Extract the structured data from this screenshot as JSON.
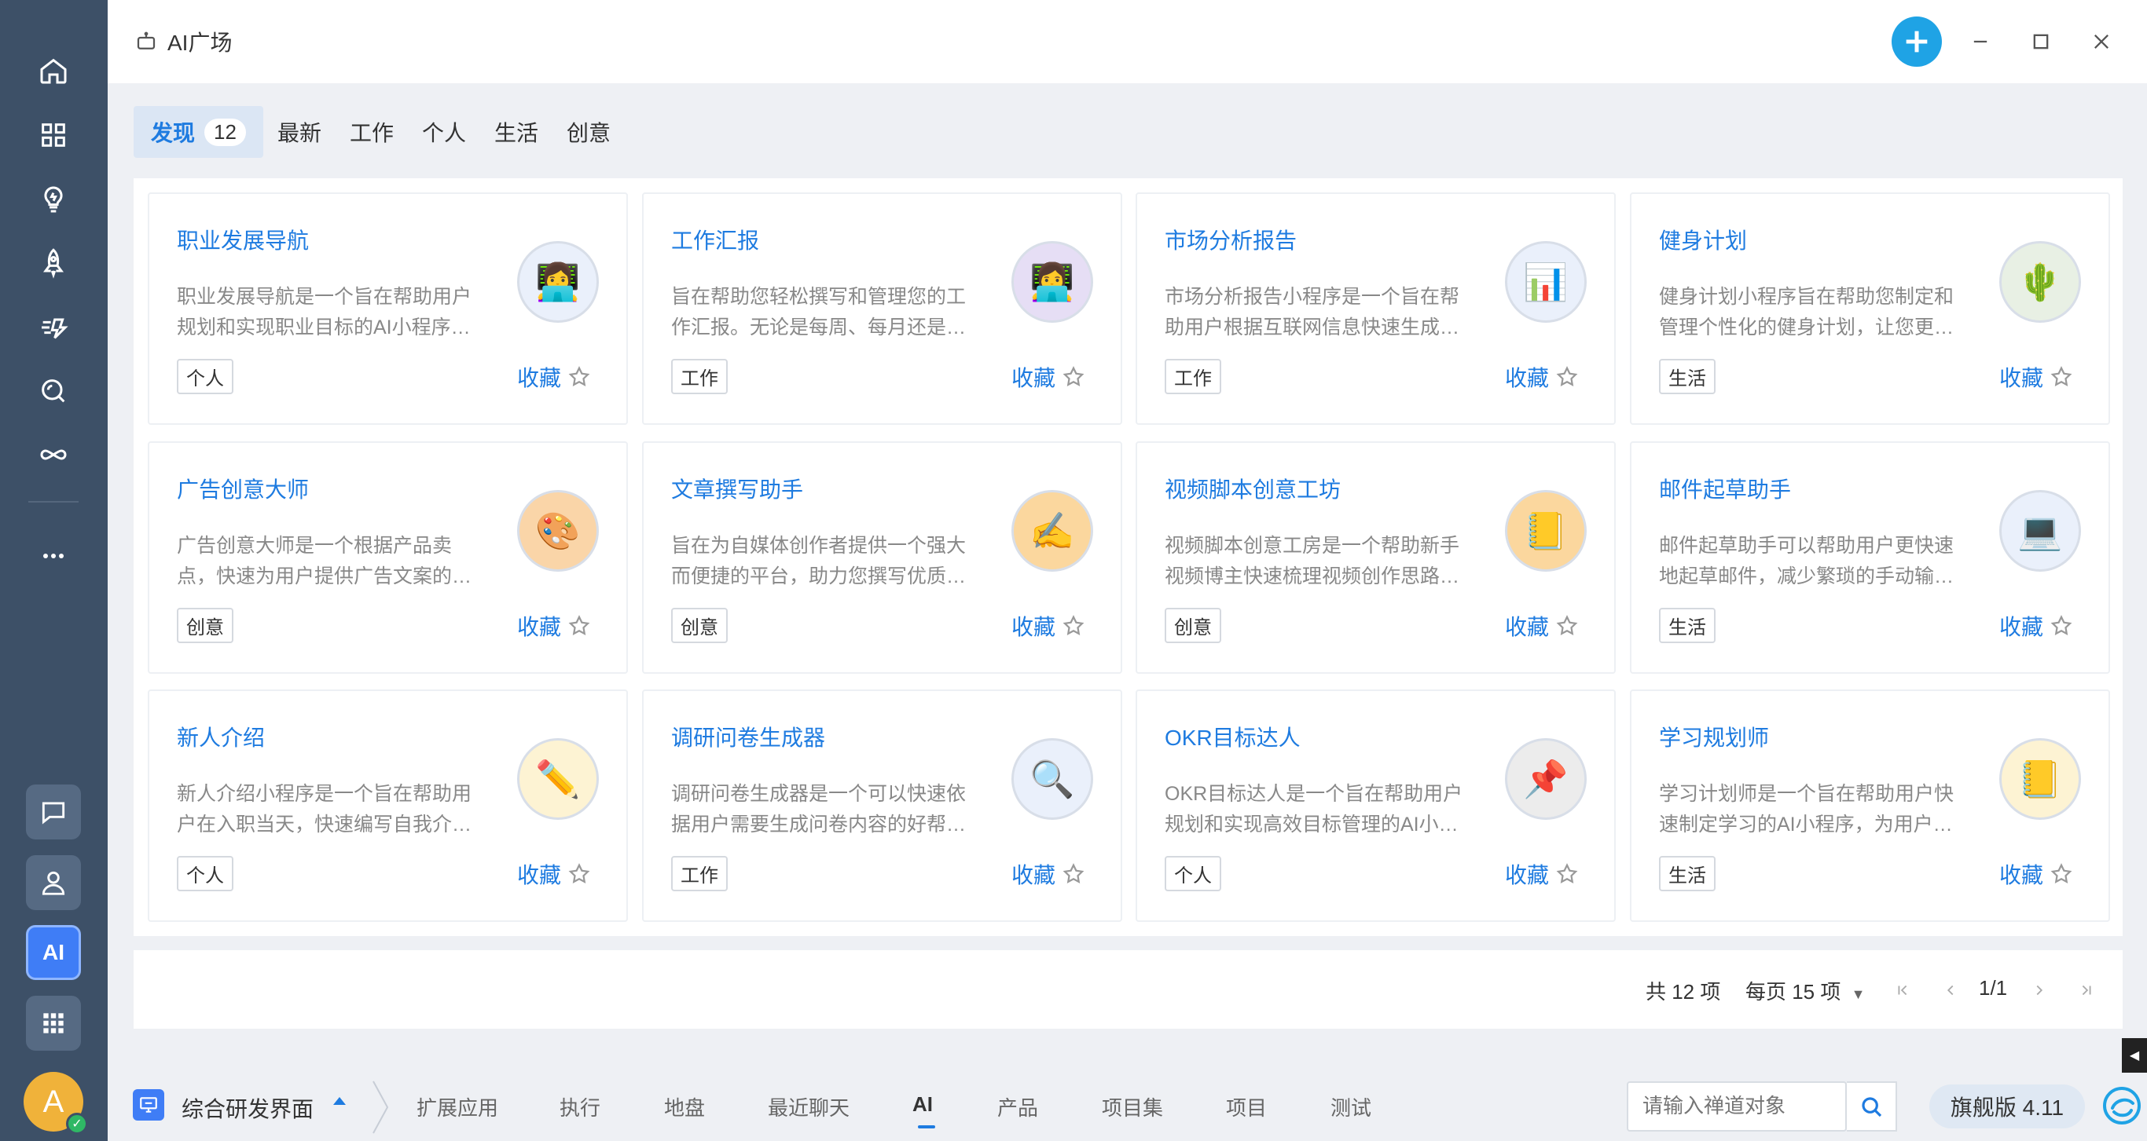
{
  "window": {
    "title": "AI广场"
  },
  "rail": {
    "icons": [
      "home-icon",
      "apps-grid-icon",
      "lightbulb-icon",
      "rocket-icon",
      "speed-icon",
      "search-chat-icon",
      "infinity-icon",
      "more-icon"
    ],
    "bottom": [
      "chat-icon",
      "user-icon",
      "ai-icon",
      "app-grid-icon"
    ],
    "ai_label": "AI",
    "avatar_letter": "A"
  },
  "tabs": [
    {
      "label": "发现",
      "count": "12",
      "active": true
    },
    {
      "label": "最新"
    },
    {
      "label": "工作"
    },
    {
      "label": "个人"
    },
    {
      "label": "生活"
    },
    {
      "label": "创意"
    }
  ],
  "fav_label": "收藏",
  "cards": [
    {
      "title": "职业发展导航",
      "desc1": "职业发展导航是一个旨在帮助用户",
      "desc2": "规划和实现职业目标的AI小程序…",
      "tag": "个人",
      "icon": "👩‍💻",
      "icon_bg": "#eaf0fb"
    },
    {
      "title": "工作汇报",
      "desc1": "旨在帮助您轻松撰写和管理您的工",
      "desc2": "作汇报。无论是每周、每月还是…",
      "tag": "工作",
      "icon": "👩‍💻",
      "icon_bg": "#e6def5"
    },
    {
      "title": "市场分析报告",
      "desc1": "市场分析报告小程序是一个旨在帮",
      "desc2": "助用户根据互联网信息快速生成…",
      "tag": "工作",
      "icon": "📊",
      "icon_bg": "#eaf0fb"
    },
    {
      "title": "健身计划",
      "desc1": "健身计划小程序旨在帮助您制定和",
      "desc2": "管理个性化的健身计划，让您更…",
      "tag": "生活",
      "icon": "🌵",
      "icon_bg": "#e8f0e4"
    },
    {
      "title": "广告创意大师",
      "desc1": "广告创意大师是一个根据产品卖",
      "desc2": "点，快速为用户提供广告文案的…",
      "tag": "创意",
      "icon": "🎨",
      "icon_bg": "#fad5a8"
    },
    {
      "title": "文章撰写助手",
      "desc1": "旨在为自媒体创作者提供一个强大",
      "desc2": "而便捷的平台，助力您撰写优质…",
      "tag": "创意",
      "icon": "✍️",
      "icon_bg": "#fbd79e"
    },
    {
      "title": "视频脚本创意工坊",
      "desc1": "视频脚本创意工房是一个帮助新手",
      "desc2": "视频博主快速梳理视频创作思路…",
      "tag": "创意",
      "icon": "📒",
      "icon_bg": "#fbd79e"
    },
    {
      "title": "邮件起草助手",
      "desc1": "邮件起草助手可以帮助用户更快速",
      "desc2": "地起草邮件，减少繁琐的手动输…",
      "tag": "生活",
      "icon": "💻",
      "icon_bg": "#eaf0fb"
    },
    {
      "title": "新人介绍",
      "desc1": "新人介绍小程序是一个旨在帮助用",
      "desc2": "户在入职当天，快速编写自我介…",
      "tag": "个人",
      "icon": "✏️",
      "icon_bg": "#fdf3d3"
    },
    {
      "title": "调研问卷生成器",
      "desc1": "调研问卷生成器是一个可以快速依",
      "desc2": "据用户需要生成问卷内容的好帮…",
      "tag": "工作",
      "icon": "🔍",
      "icon_bg": "#eaf0fb"
    },
    {
      "title": "OKR目标达人",
      "desc1": "OKR目标达人是一个旨在帮助用户",
      "desc2": "规划和实现高效目标管理的AI小…",
      "tag": "个人",
      "icon": "📌",
      "icon_bg": "#ececec"
    },
    {
      "title": "学习规划师",
      "desc1": "学习计划师是一个旨在帮助用户快",
      "desc2": "速制定学习的AI小程序，为用户…",
      "tag": "生活",
      "icon": "📒",
      "icon_bg": "#fdf3d3"
    }
  ],
  "pagination": {
    "total": "共 12 项",
    "per_page": "每页 15 项",
    "page": "1/1"
  },
  "bottom": {
    "workspace": "综合研发界面",
    "nav": [
      "扩展应用",
      "执行",
      "地盘",
      "最近聊天",
      "AI",
      "产品",
      "项目集",
      "项目",
      "测试"
    ],
    "active_nav": "AI",
    "search_placeholder": "请输入禅道对象",
    "version": "旗舰版 4.11"
  }
}
